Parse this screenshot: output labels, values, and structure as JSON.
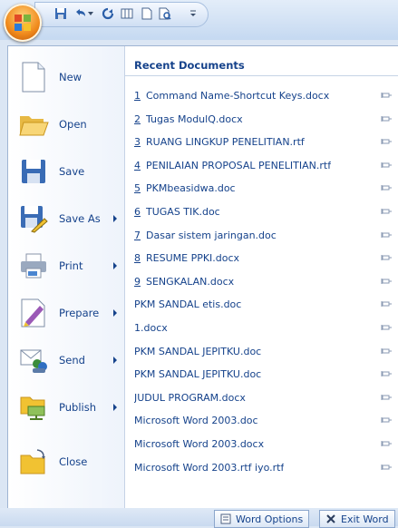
{
  "menu": {
    "commands": [
      {
        "label": "New",
        "icon": "new-document-icon",
        "has_submenu": false
      },
      {
        "label": "Open",
        "icon": "open-folder-icon",
        "has_submenu": false
      },
      {
        "label": "Save",
        "icon": "save-disk-icon",
        "has_submenu": false
      },
      {
        "label": "Save As",
        "icon": "save-as-icon",
        "has_submenu": true
      },
      {
        "label": "Print",
        "icon": "printer-icon",
        "has_submenu": true
      },
      {
        "label": "Prepare",
        "icon": "prepare-icon",
        "has_submenu": true
      },
      {
        "label": "Send",
        "icon": "send-icon",
        "has_submenu": true
      },
      {
        "label": "Publish",
        "icon": "publish-icon",
        "has_submenu": true
      },
      {
        "label": "Close",
        "icon": "close-folder-icon",
        "has_submenu": false
      }
    ]
  },
  "recent": {
    "title": "Recent Documents",
    "documents": [
      {
        "num": "1",
        "name": "Command Name-Shortcut Keys.docx"
      },
      {
        "num": "2",
        "name": "Tugas ModulQ.docx"
      },
      {
        "num": "3",
        "name": "RUANG LINGKUP PENELITIAN.rtf"
      },
      {
        "num": "4",
        "name": "PENILAIAN PROPOSAL PENELITIAN.rtf"
      },
      {
        "num": "5",
        "name": "PKMbeasidwa.doc"
      },
      {
        "num": "6",
        "name": "TUGAS TIK.doc"
      },
      {
        "num": "7",
        "name": "Dasar sistem jaringan.doc"
      },
      {
        "num": "8",
        "name": "RESUME PPKI.docx"
      },
      {
        "num": "9",
        "name": "SENGKALAN.docx"
      },
      {
        "num": "",
        "name": "PKM SANDAL etis.doc"
      },
      {
        "num": "",
        "name": "1.docx"
      },
      {
        "num": "",
        "name": "PKM SANDAL JEPITKU.doc"
      },
      {
        "num": "",
        "name": "PKM SANDAL JEPITKU.doc"
      },
      {
        "num": "",
        "name": "JUDUL PROGRAM.docx"
      },
      {
        "num": "",
        "name": "Microsoft Word 2003.doc"
      },
      {
        "num": "",
        "name": "Microsoft Word 2003.docx"
      },
      {
        "num": "",
        "name": "Microsoft Word 2003.rtf iyo.rtf"
      }
    ]
  },
  "footer": {
    "options_label": "Word Options",
    "exit_label": "Exit Word"
  }
}
